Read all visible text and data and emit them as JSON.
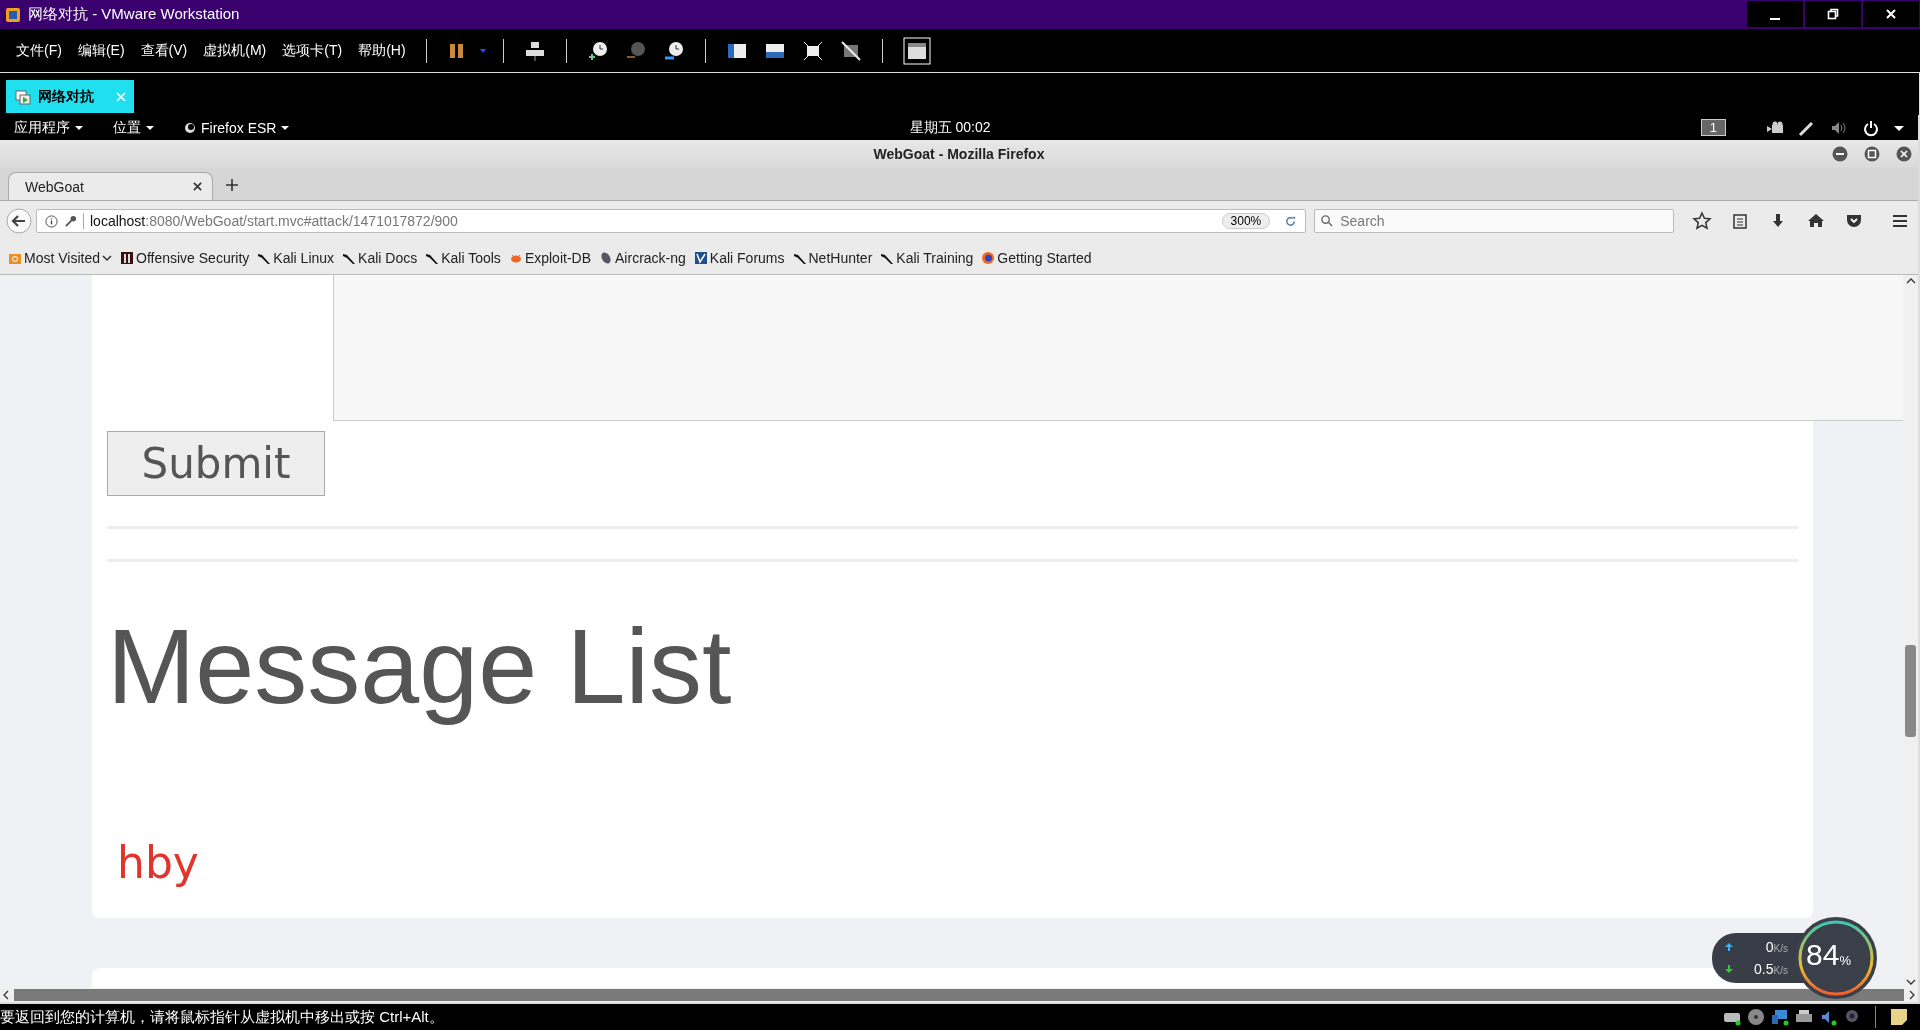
{
  "vmware": {
    "title": "网络对抗 - VMware Workstation",
    "menu": [
      "文件(F)",
      "编辑(E)",
      "查看(V)",
      "虚拟机(M)",
      "选项卡(T)",
      "帮助(H)"
    ],
    "vm_tab": {
      "label": "网络对抗",
      "selected": true
    }
  },
  "kali_panel": {
    "applications": "应用程序",
    "places": "位置",
    "app": "Firefox ESR",
    "clock": "星期五 00:02",
    "workspace": "1"
  },
  "firefox": {
    "title": "WebGoat - Mozilla Firefox",
    "tabs": [
      {
        "label": "WebGoat",
        "selected": true
      }
    ],
    "url_host": "localhost",
    "url_rest": ":8080/WebGoat/start.mvc#attack/1471017872/900",
    "zoom": "300%",
    "search": {
      "placeholder": "Search"
    },
    "bookmarks": [
      {
        "label": "Most Visited",
        "kind": "folder"
      },
      {
        "label": "Offensive Security",
        "kind": "offsec"
      },
      {
        "label": "Kali Linux",
        "kind": "kali"
      },
      {
        "label": "Kali Docs",
        "kind": "kali"
      },
      {
        "label": "Kali Tools",
        "kind": "kali"
      },
      {
        "label": "Exploit-DB",
        "kind": "bug"
      },
      {
        "label": "Aircrack-ng",
        "kind": "dish"
      },
      {
        "label": "Kali Forums",
        "kind": "forum"
      },
      {
        "label": "NetHunter",
        "kind": "kali"
      },
      {
        "label": "Kali Training",
        "kind": "kali"
      },
      {
        "label": "Getting Started",
        "kind": "firefox"
      }
    ]
  },
  "page": {
    "submit": "Submit",
    "heading": "Message List",
    "messages": [
      "hby"
    ]
  },
  "status_bar": "要返回到您的计算机，请将鼠标指针从虚拟机中移出或按 Ctrl+Alt。",
  "net_widget": {
    "upload": "0",
    "upload_unit": "K/s",
    "download": "0.5",
    "download_unit": "K/s",
    "percent": "84",
    "percent_unit": "%"
  }
}
